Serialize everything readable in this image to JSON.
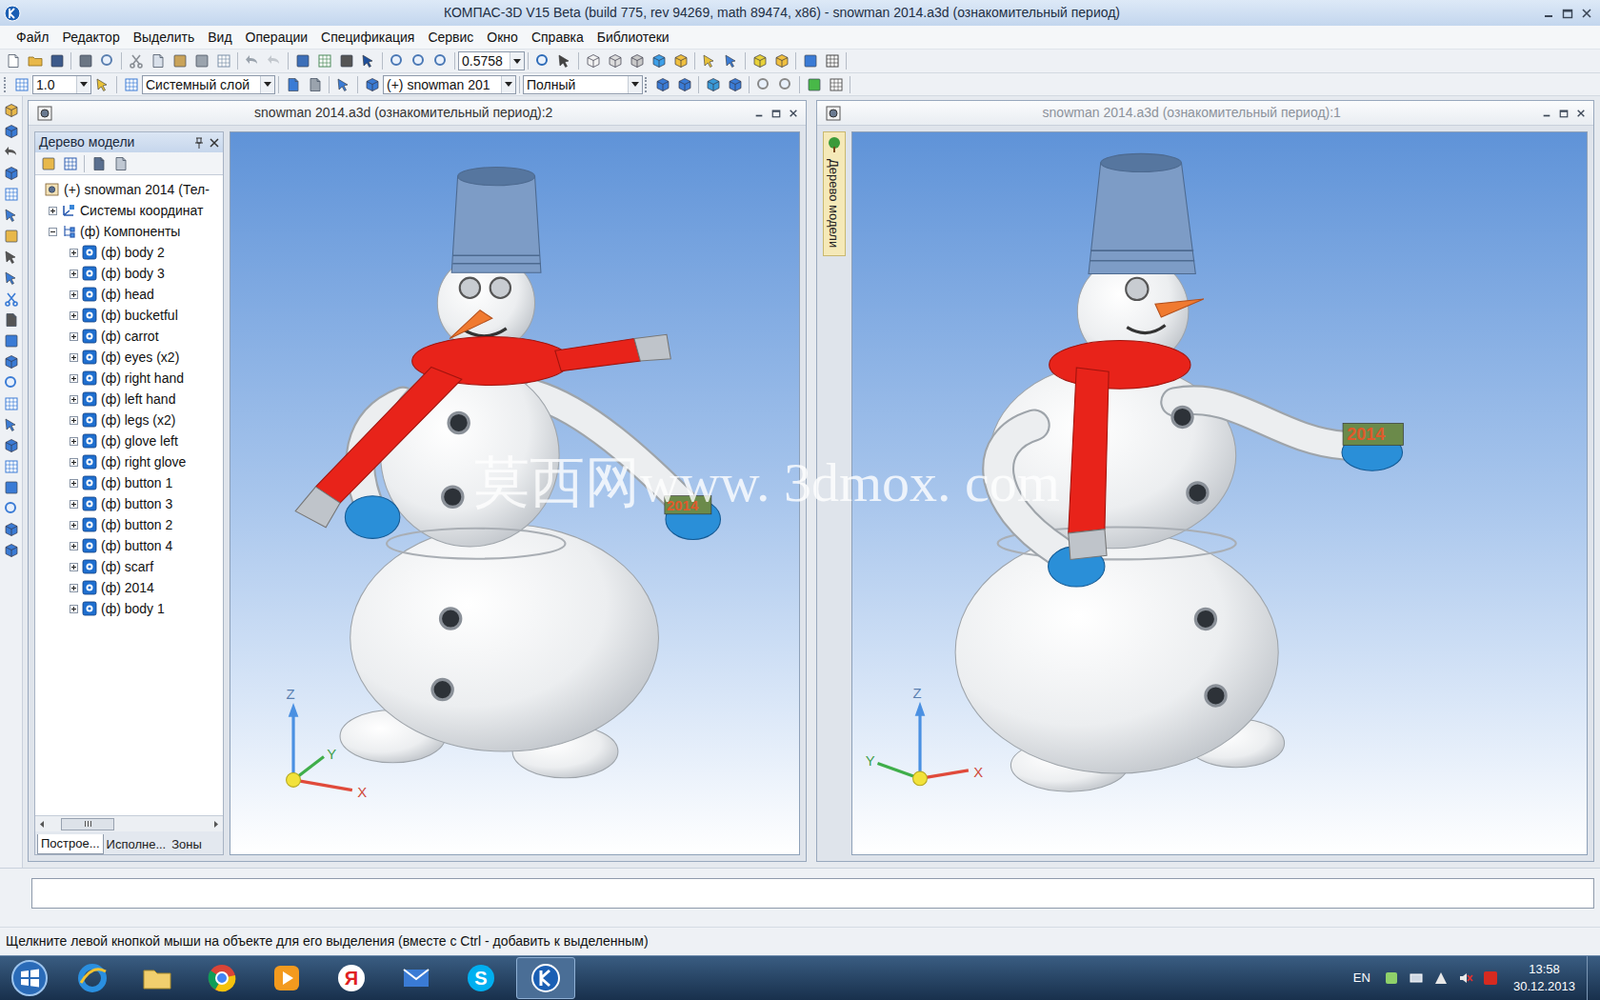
{
  "window": {
    "title": "КОМПАС-3D V15 Beta (build 775, rev 94269, math 89474, x86) - snowman 2014.a3d (ознакомительный период)"
  },
  "menu": [
    "Файл",
    "Редактор",
    "Выделить",
    "Вид",
    "Операции",
    "Спецификация",
    "Сервис",
    "Окно",
    "Справка",
    "Библиотеки"
  ],
  "toolbar1": {
    "zoom": "0.5758"
  },
  "toolbar2": {
    "scale": "1.0",
    "layer": "Системный слой",
    "component": "(+) snowman 201",
    "mode": "Полный"
  },
  "tree": {
    "title": "Дерево модели",
    "items": [
      {
        "label": "(+) snowman 2014 (Тел-",
        "level": 0,
        "kind": "assembly",
        "expandable": false,
        "expanded": false
      },
      {
        "label": "Системы координат",
        "level": 1,
        "kind": "coords",
        "expandable": true,
        "expanded": false
      },
      {
        "label": "(ф) Компоненты",
        "level": 1,
        "kind": "group",
        "expandable": true,
        "expanded": true
      },
      {
        "label": "(ф) body 2",
        "level": 2,
        "kind": "part",
        "expandable": true,
        "expanded": false
      },
      {
        "label": "(ф) body 3",
        "level": 2,
        "kind": "part",
        "expandable": true,
        "expanded": false
      },
      {
        "label": "(ф) head",
        "level": 2,
        "kind": "part",
        "expandable": true,
        "expanded": false
      },
      {
        "label": "(ф) bucketful",
        "level": 2,
        "kind": "part",
        "expandable": true,
        "expanded": false
      },
      {
        "label": "(ф) carrot",
        "level": 2,
        "kind": "part",
        "expandable": true,
        "expanded": false
      },
      {
        "label": "(ф) eyes (x2)",
        "level": 2,
        "kind": "part",
        "expandable": true,
        "expanded": false
      },
      {
        "label": "(ф) right hand",
        "level": 2,
        "kind": "part",
        "expandable": true,
        "expanded": false
      },
      {
        "label": "(ф) left hand",
        "level": 2,
        "kind": "part",
        "expandable": true,
        "expanded": false
      },
      {
        "label": "(ф) legs (x2)",
        "level": 2,
        "kind": "part",
        "expandable": true,
        "expanded": false
      },
      {
        "label": "(ф) glove left",
        "level": 2,
        "kind": "part",
        "expandable": true,
        "expanded": false
      },
      {
        "label": "(ф) right glove",
        "level": 2,
        "kind": "part",
        "expandable": true,
        "expanded": false
      },
      {
        "label": "(ф) button 1",
        "level": 2,
        "kind": "part",
        "expandable": true,
        "expanded": false
      },
      {
        "label": "(ф) button 3",
        "level": 2,
        "kind": "part",
        "expandable": true,
        "expanded": false
      },
      {
        "label": "(ф) button 2",
        "level": 2,
        "kind": "part",
        "expandable": true,
        "expanded": false
      },
      {
        "label": "(ф) button 4",
        "level": 2,
        "kind": "part",
        "expandable": true,
        "expanded": false
      },
      {
        "label": "(ф) scarf",
        "level": 2,
        "kind": "part",
        "expandable": true,
        "expanded": false
      },
      {
        "label": "(ф) 2014",
        "level": 2,
        "kind": "part",
        "expandable": true,
        "expanded": false
      },
      {
        "label": "(ф) body 1",
        "level": 2,
        "kind": "part",
        "expandable": true,
        "expanded": false
      }
    ],
    "tabs": [
      {
        "label": "Построе...",
        "selected": true
      },
      {
        "label": "Исполне...",
        "selected": false
      },
      {
        "label": "Зоны",
        "selected": false
      }
    ]
  },
  "views": [
    {
      "title": "snowman 2014.a3d (ознакомительный период):2",
      "active": true,
      "tree_open": true,
      "kind": "front",
      "axes": [
        "Z",
        "Y",
        "X"
      ],
      "model_text": "2014"
    },
    {
      "title": "snowman 2014.a3d (ознакомительный период):1",
      "active": false,
      "tree_open": false,
      "kind": "turned",
      "axes": [
        "Z",
        "Y",
        "X"
      ],
      "model_text": "2014"
    }
  ],
  "collapsed_tree_tab": "Дерево модели",
  "watermark": "莫西网www. 3dmox. com",
  "command_line": {
    "value": ""
  },
  "status_bar": "Щелкните левой кнопкой мыши на объекте для его выделения (вместе с Ctrl - добавить к выделенным)",
  "taskbar": {
    "apps": [
      {
        "kind": "ie",
        "glyph": "",
        "active": false
      },
      {
        "kind": "folder",
        "glyph": "",
        "active": false
      },
      {
        "kind": "chrome",
        "glyph": "",
        "active": false
      },
      {
        "kind": "media",
        "glyph": "",
        "active": false
      },
      {
        "kind": "yandex",
        "glyph": "Я",
        "active": false
      },
      {
        "kind": "mail",
        "glyph": "",
        "active": false
      },
      {
        "kind": "skype",
        "glyph": "S",
        "active": false
      },
      {
        "kind": "kompas",
        "glyph": "",
        "active": true
      }
    ],
    "lang": "EN",
    "time": "13:58",
    "date": "30.12.2013"
  }
}
